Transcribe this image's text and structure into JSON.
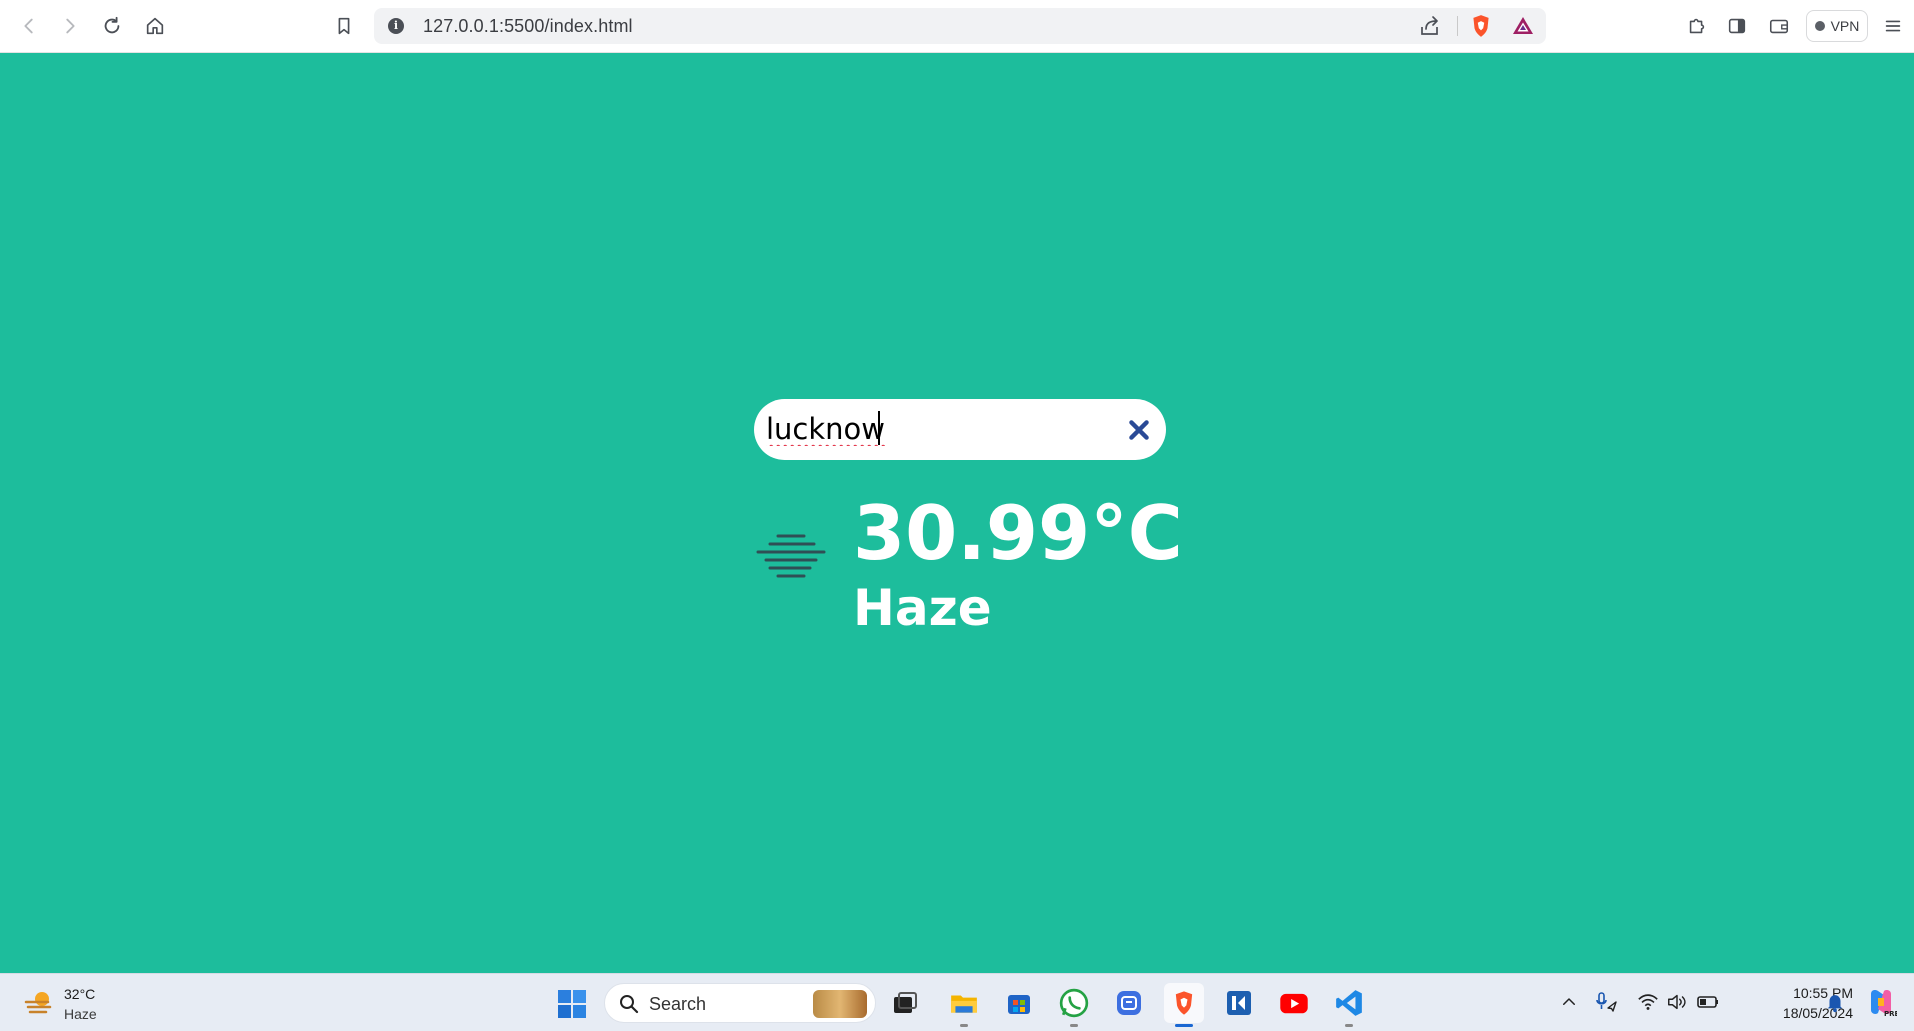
{
  "browser": {
    "url": "127.0.0.1:5500/index.html",
    "vpn_label": "VPN"
  },
  "page": {
    "search": {
      "value": "lucknow",
      "clear_icon": "close-icon"
    },
    "weather": {
      "icon": "haze-icon",
      "temperature": "30.99°C",
      "condition": "Haze"
    },
    "colors": {
      "background": "#1dbd9c",
      "text": "#ffffff",
      "clear_icon": "#2a4a96"
    }
  },
  "taskbar": {
    "weather_widget": {
      "temperature": "32°C",
      "condition": "Haze"
    },
    "search_label": "Search",
    "apps": [
      "task-view",
      "file-explorer",
      "microsoft-store",
      "whatsapp",
      "teams-chat",
      "brave-browser",
      "kdenlive",
      "youtube",
      "vs-code"
    ],
    "clock": {
      "time": "10:55 PM",
      "date": "18/05/2024"
    }
  }
}
